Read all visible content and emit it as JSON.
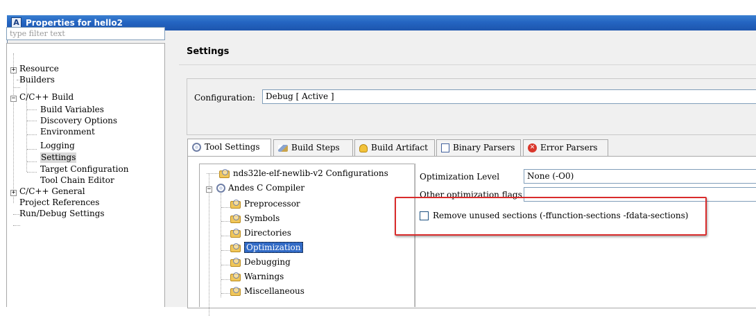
{
  "window": {
    "title": "Properties for hello2",
    "app_icon_letter": "A"
  },
  "filter": {
    "placeholder": "type filter text"
  },
  "nav_tree": {
    "resource": "Resource",
    "builders": "Builders",
    "cc_build": "C/C++ Build",
    "build_variables": "Build Variables",
    "discovery_options": "Discovery Options",
    "environment": "Environment",
    "logging": "Logging",
    "settings": "Settings",
    "target_configuration": "Target Configuration",
    "tool_chain_editor": "Tool Chain Editor",
    "cc_general": "C/C++ General",
    "project_references": "Project References",
    "run_debug_settings": "Run/Debug Settings",
    "selected": "Settings"
  },
  "header": {
    "title": "Settings"
  },
  "configuration": {
    "label": "Configuration:",
    "value": "Debug  [ Active ]"
  },
  "tabs": {
    "tool_settings": "Tool Settings",
    "build_steps": "Build Steps",
    "build_artifact": "Build Artifact",
    "binary_parsers": "Binary Parsers",
    "error_parsers": "Error Parsers",
    "active": "Tool Settings"
  },
  "tool_tree": {
    "configurations": "nds32le-elf-newlib-v2 Configurations",
    "compiler": "Andes C Compiler",
    "preprocessor": "Preprocessor",
    "symbols": "Symbols",
    "directories": "Directories",
    "optimization": "Optimization",
    "debugging": "Debugging",
    "warnings": "Warnings",
    "miscellaneous": "Miscellaneous",
    "selected": "Optimization"
  },
  "optimization": {
    "level_label": "Optimization Level",
    "level_value": "None (-O0)",
    "other_flags_label": "Other optimization flags",
    "other_flags_value": "",
    "remove_unused_label": "Remove unused sections (-ffunction-sections -fdata-sections)",
    "remove_unused_checked": false
  },
  "colors": {
    "title_bar": "#2465c2",
    "highlight_box": "#d92b2b",
    "selection": "#316ac5"
  }
}
